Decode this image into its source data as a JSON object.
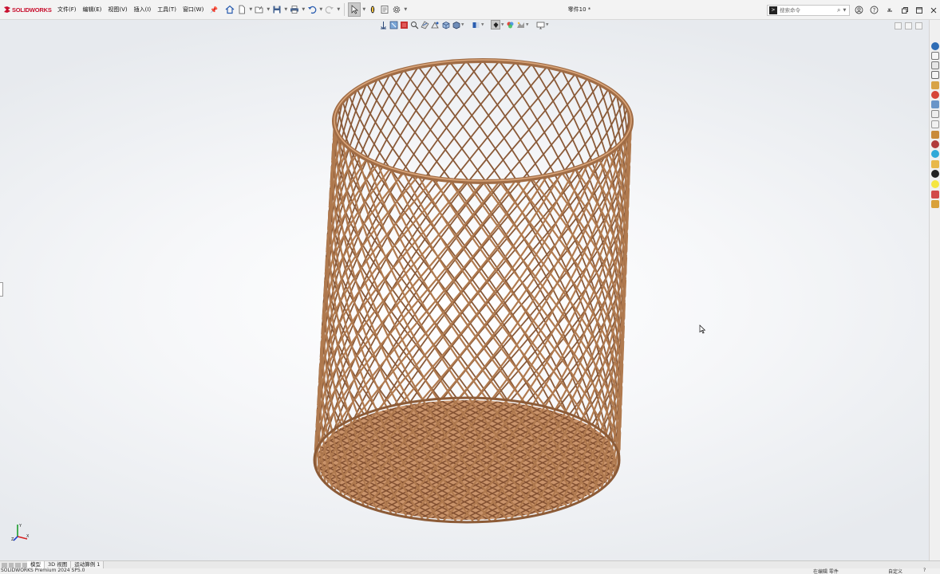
{
  "app": {
    "logo_text": "SOLIDWORKS",
    "document_title": "零件10 *"
  },
  "menu": {
    "items": [
      "文件(F)",
      "编辑(E)",
      "视图(V)",
      "插入(I)",
      "工具(T)",
      "窗口(W)"
    ],
    "pin_icon": "pin-icon"
  },
  "quick_access": {
    "icons": [
      "home-icon",
      "new-document-icon",
      "open-icon",
      "save-icon",
      "print-icon",
      "undo-icon",
      "redo-icon",
      "select-pointer-icon",
      "rebuild-icon",
      "options-gear-icon"
    ]
  },
  "search": {
    "placeholder": "搜索命令",
    "icon": "search-icon"
  },
  "window_controls": {
    "icons": [
      "help-circle-icon",
      "question-icon",
      "minimize-icon",
      "restore-icon",
      "maximize-icon",
      "close-icon"
    ]
  },
  "hud_toolbar": {
    "icons": [
      "zoom-to-fit-icon",
      "zoom-area-icon",
      "previous-view-icon",
      "section-view-icon",
      "dynamic-annotation-icon",
      "view-orientation-icon",
      "display-style-icon",
      "hide-show-items-icon",
      "edit-appearance-icon",
      "apply-scene-icon",
      "view-settings-icon",
      "display-manager-icon"
    ]
  },
  "model": {
    "name": "wire mesh basket",
    "color": "#b07a4f"
  },
  "task_pane": {
    "icons": [
      "solidworks-resources-icon",
      "design-library-icon",
      "file-explorer-icon",
      "view-palette-icon",
      "appearances-icon",
      "custom-properties-icon",
      "forum-icon",
      "toolbox-icon",
      "sketch-icon",
      "folder-icon",
      "3d-content-icon",
      "simulation-icon",
      "layers-icon",
      "lightbulb-icon",
      "mate-icon",
      "extra-icon"
    ]
  },
  "bottom_tabs": {
    "items": [
      "模型",
      "3D 视图",
      "运动算例 1"
    ],
    "active": "模型"
  },
  "status": {
    "product": "SOLIDWORKS Premium 2024 SP5.0",
    "mode": "在编辑 零件",
    "units": "自定义"
  }
}
